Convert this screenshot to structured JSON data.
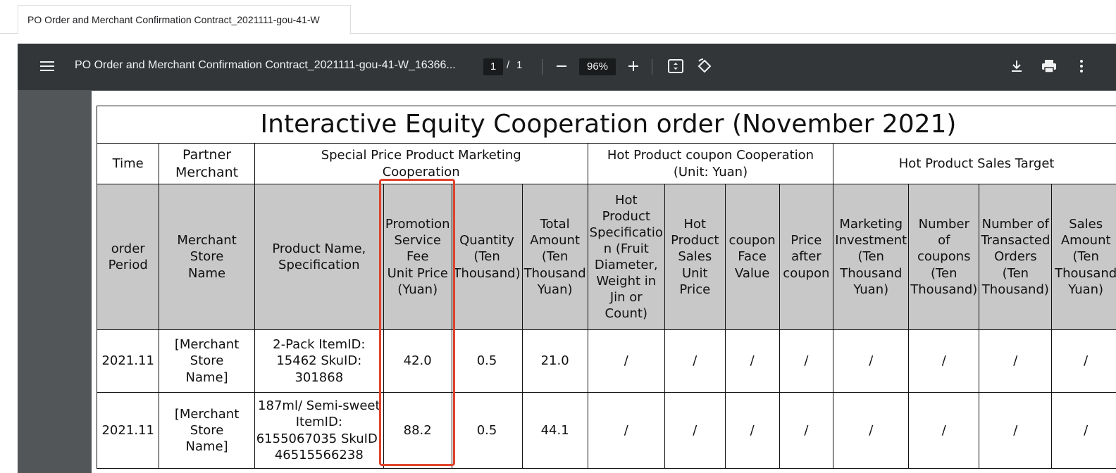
{
  "browser": {
    "tab_title": "PO Order and Merchant Confirmation Contract_2021111-gou-41-W"
  },
  "toolbar": {
    "doc_title": "PO Order and Merchant Confirmation Contract_2021111-gou-41-W_16366...",
    "page_current": "1",
    "page_separator": "/",
    "page_total": "1",
    "zoom": "96%",
    "icons": [
      "menu-icon",
      "zoom-out-icon",
      "zoom-in-icon",
      "fit-page-icon",
      "rotate-icon",
      "download-icon",
      "print-icon",
      "more-options-icon"
    ]
  },
  "table": {
    "title": "Interactive Equity Cooperation order (November 2021)",
    "groups": {
      "time": "Time",
      "partner": "Partner Merchant",
      "special_line1": "Special Price Product Marketing",
      "special_line2": "Cooperation",
      "coupon_line1": "Hot Product coupon Cooperation",
      "coupon_line2": "(Unit: Yuan)",
      "sales_target": "Hot Product Sales Target"
    },
    "headers": [
      [
        "order",
        "Period"
      ],
      [
        "Merchant Store",
        "Name"
      ],
      [
        "Product Name,",
        "Specification"
      ],
      [
        "Promotion",
        "Service Fee",
        "Unit Price",
        "(Yuan)"
      ],
      [
        "Quantity",
        "(Ten",
        "Thousand)"
      ],
      [
        "Total",
        "Amount",
        "(Ten",
        "Thousand",
        "Yuan)"
      ],
      [
        "Hot Product",
        "Specificatio",
        "n (Fruit",
        "Diameter,",
        "Weight in",
        "Jin or",
        "Count)"
      ],
      [
        "Hot",
        "Product",
        "Sales Unit",
        "Price"
      ],
      [
        "coupon",
        "Face",
        "Value"
      ],
      [
        "Price",
        "after",
        "coupon"
      ],
      [
        "Marketing",
        "Investment",
        "(Ten",
        "Thousand",
        "Yuan)"
      ],
      [
        "Number of",
        "coupons",
        "(Ten",
        "Thousand)"
      ],
      [
        "Number of",
        "Transacted",
        "Orders",
        "(Ten",
        "Thousand)"
      ],
      [
        "Sales",
        "Amount",
        "(Ten",
        "Thousand",
        "Yuan)"
      ]
    ],
    "rows": [
      {
        "period": "2021.11",
        "store": [
          "[Merchant Store",
          "Name]"
        ],
        "product": [
          "2-Pack ItemID:",
          "15462 SkuID:",
          "301868"
        ],
        "unit_price": "42.0",
        "quantity": "0.5",
        "total": "21.0",
        "slashes": [
          "/",
          "/",
          "/",
          "/",
          "/",
          "/",
          "/",
          "/"
        ]
      },
      {
        "period": "2021.11",
        "store": [
          "[Merchant Store",
          "Name]"
        ],
        "product": [
          "187ml/ Semi-sweet",
          "ItemID:",
          "6155067035 SkuID:",
          "46515566238"
        ],
        "unit_price": "88.2",
        "quantity": "0.5",
        "total": "44.1",
        "slashes": [
          "/",
          "/",
          "/",
          "/",
          "/",
          "/",
          "/",
          "/"
        ]
      }
    ]
  },
  "colors": {
    "toolbar_bg": "#323639",
    "viewer_bg": "#525659",
    "header_fill": "#c8c8c8",
    "highlight": "#e0442d"
  }
}
